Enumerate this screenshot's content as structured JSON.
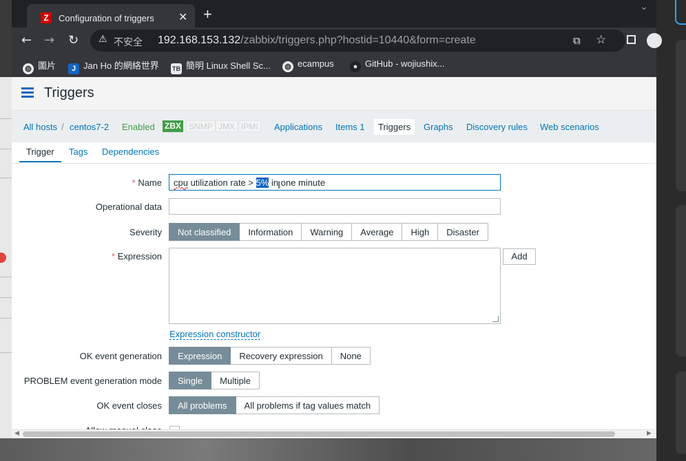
{
  "browser": {
    "tab_title": "Configuration of triggers",
    "tab_favicon": "Z",
    "new_tab_glyph": "+",
    "close_glyph": "✕",
    "insecure_label": "不安全",
    "url_host": "192.168.153.132",
    "url_path": "/zabbix/triggers.php?hostid=10440&form=create",
    "bookmarks": [
      {
        "icon": "globe-icon",
        "label": "圖片"
      },
      {
        "icon": "J",
        "label": "Jan Ho 的網絡世界"
      },
      {
        "icon": "TB",
        "label": "簡明 Linux Shell Sc..."
      },
      {
        "icon": "globe-icon",
        "label": "ecampus"
      },
      {
        "icon": "github-icon",
        "label": "GitHub - wojiushix..."
      }
    ]
  },
  "page": {
    "title": "Triggers"
  },
  "breadcrumb": {
    "all_hosts": "All hosts",
    "separator": "/",
    "host": "centos7-2",
    "status": "Enabled",
    "availability": [
      "ZBX",
      "SNMP",
      "JMX",
      "IPMI"
    ],
    "links": [
      "Applications",
      "Items 1",
      "Triggers",
      "Graphs",
      "Discovery rules",
      "Web scenarios"
    ],
    "active_link": "Triggers"
  },
  "form_tabs": [
    "Trigger",
    "Tags",
    "Dependencies"
  ],
  "form": {
    "required_mark": "*",
    "name_label": "Name",
    "name_value_pre": "cpu",
    "name_value_mid": " utilization rate > ",
    "name_value_selected": "5%",
    "name_value_post": " in one minute",
    "opdata_label": "Operational data",
    "opdata_value": "",
    "severity_label": "Severity",
    "severity_options": [
      "Not classified",
      "Information",
      "Warning",
      "Average",
      "High",
      "Disaster"
    ],
    "severity_selected": "Not classified",
    "expression_label": "Expression",
    "expression_value": "",
    "add_button": "Add",
    "expression_constructor": "Expression constructor",
    "ok_event_generation_label": "OK event generation",
    "ok_event_generation_options": [
      "Expression",
      "Recovery expression",
      "None"
    ],
    "problem_mode_label": "PROBLEM event generation mode",
    "problem_mode_options": [
      "Single",
      "Multiple"
    ],
    "ok_event_closes_label": "OK event closes",
    "ok_event_closes_options": [
      "All problems",
      "All problems if tag values match"
    ],
    "allow_manual_close_label": "Allow manual close"
  },
  "colors": {
    "accent": "#0275b8",
    "selected_segment": "#768d99",
    "enabled_green": "#429e47",
    "required_red": "#e45959"
  }
}
